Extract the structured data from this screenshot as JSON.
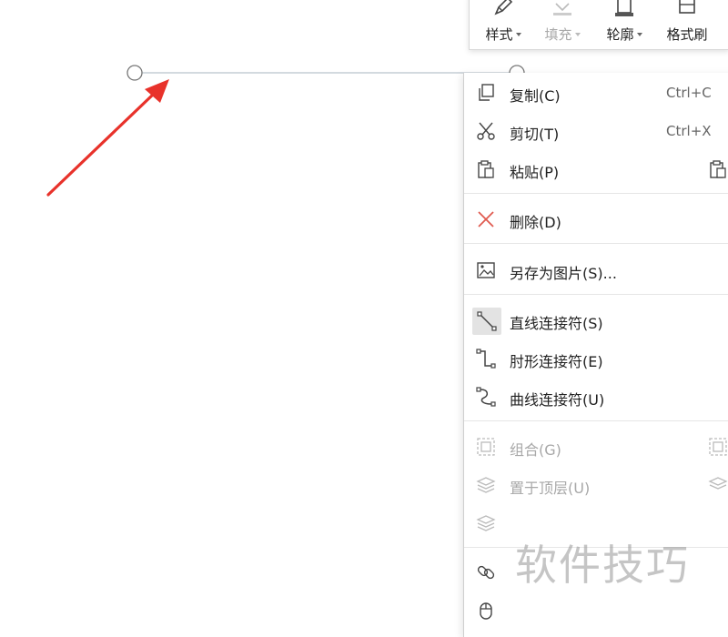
{
  "mini_toolbar": {
    "buttons": [
      {
        "label": "样式",
        "icon": "pen-icon",
        "enabled": true
      },
      {
        "label": "填充",
        "icon": "fill-icon",
        "enabled": false
      },
      {
        "label": "轮廓",
        "icon": "outline-icon",
        "enabled": true
      },
      {
        "label": "格式刷",
        "icon": "format-painter-icon",
        "enabled": true
      }
    ]
  },
  "context_menu": {
    "items": [
      {
        "label": "复制(C)",
        "shortcut": "Ctrl+C",
        "icon": "copy-icon",
        "enabled": true
      },
      {
        "label": "剪切(T)",
        "shortcut": "Ctrl+X",
        "icon": "scissors-icon",
        "enabled": true
      },
      {
        "label": "粘贴(P)",
        "shortcut": "",
        "icon": "paste-icon",
        "enabled": true
      },
      {
        "label": "删除(D)",
        "shortcut": "",
        "icon": "delete-icon",
        "enabled": true
      },
      {
        "label": "另存为图片(S)...",
        "shortcut": "",
        "icon": "save-as-image-icon",
        "enabled": true
      },
      {
        "label": "直线连接符(S)",
        "shortcut": "",
        "icon": "straight-connector-icon",
        "enabled": true,
        "selected": true
      },
      {
        "label": "肘形连接符(E)",
        "shortcut": "",
        "icon": "elbow-connector-icon",
        "enabled": true
      },
      {
        "label": "曲线连接符(U)",
        "shortcut": "",
        "icon": "curved-connector-icon",
        "enabled": true
      },
      {
        "label": "组合(G)",
        "shortcut": "",
        "icon": "group-icon",
        "enabled": false
      },
      {
        "label": "置于顶层(U)",
        "shortcut": "",
        "icon": "bring-to-front-icon",
        "enabled": false
      }
    ]
  },
  "watermark": "软件技巧",
  "colors": {
    "arrow": "#e8322b",
    "selected_bg": "#e3e3e3",
    "disabled_text": "#a8a8a8",
    "line": "#b9c3cc"
  }
}
